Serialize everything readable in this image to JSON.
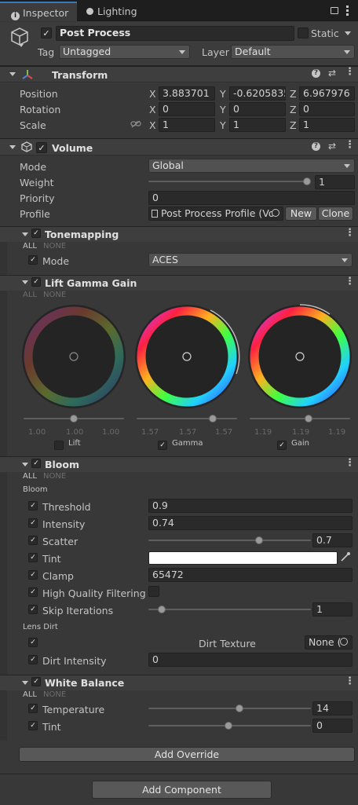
{
  "tabs": {
    "inspector": "Inspector",
    "lighting": "Lighting"
  },
  "gameobject": {
    "name": "Post Process",
    "static_label": "Static",
    "tag_label": "Tag",
    "tag_value": "Untagged",
    "layer_label": "Layer",
    "layer_value": "Default"
  },
  "transform": {
    "title": "Transform",
    "position_label": "Position",
    "rotation_label": "Rotation",
    "scale_label": "Scale",
    "axes": {
      "x": "X",
      "y": "Y",
      "z": "Z"
    },
    "position": {
      "x": "3.883701",
      "y": "-0.6205835",
      "z": "6.967976"
    },
    "rotation": {
      "x": "0",
      "y": "0",
      "z": "0"
    },
    "scale": {
      "x": "1",
      "y": "1",
      "z": "1"
    }
  },
  "volume": {
    "title": "Volume",
    "mode_label": "Mode",
    "mode_value": "Global",
    "weight_label": "Weight",
    "weight_value": "1",
    "priority_label": "Priority",
    "priority_value": "0",
    "profile_label": "Profile",
    "profile_value": "Post Process Profile (Vol",
    "new_label": "New",
    "clone_label": "Clone"
  },
  "all_label": "ALL",
  "none_label": "NONE",
  "tonemapping": {
    "title": "Tonemapping",
    "mode_label": "Mode",
    "mode_value": "ACES"
  },
  "lgg": {
    "title": "Lift Gamma Gain",
    "lift": {
      "label": "Lift",
      "values": [
        "1.00",
        "1.00",
        "1.00"
      ],
      "slider": 0.5
    },
    "gamma": {
      "label": "Gamma",
      "values": [
        "1.57",
        "1.57",
        "1.57"
      ],
      "slider": 0.8
    },
    "gain": {
      "label": "Gain",
      "values": [
        "1.19",
        "1.19",
        "1.19"
      ],
      "slider": 0.6
    }
  },
  "bloom": {
    "title": "Bloom",
    "section_label": "Bloom",
    "threshold_label": "Threshold",
    "threshold_value": "0.9",
    "intensity_label": "Intensity",
    "intensity_value": "0.74",
    "scatter_label": "Scatter",
    "scatter_value": "0.7",
    "scatter_fraction": 0.7,
    "tint_label": "Tint",
    "tint_color": "#ffffff",
    "clamp_label": "Clamp",
    "clamp_value": "65472",
    "hq_label": "High Quality Filtering",
    "skip_label": "Skip Iterations",
    "skip_value": "1",
    "lens_dirt_label": "Lens Dirt",
    "dirt_texture_label": "Dirt Texture",
    "dirt_texture_value": "None (",
    "dirt_intensity_label": "Dirt Intensity",
    "dirt_intensity_value": "0"
  },
  "white_balance": {
    "title": "White Balance",
    "temperature_label": "Temperature",
    "temperature_value": "14",
    "tint_label": "Tint",
    "tint_value": "0"
  },
  "add_override_label": "Add Override",
  "add_component_label": "Add Component",
  "colors": {
    "accent": "#3a79bb",
    "background": "#383838",
    "header": "#3e3e3e"
  }
}
